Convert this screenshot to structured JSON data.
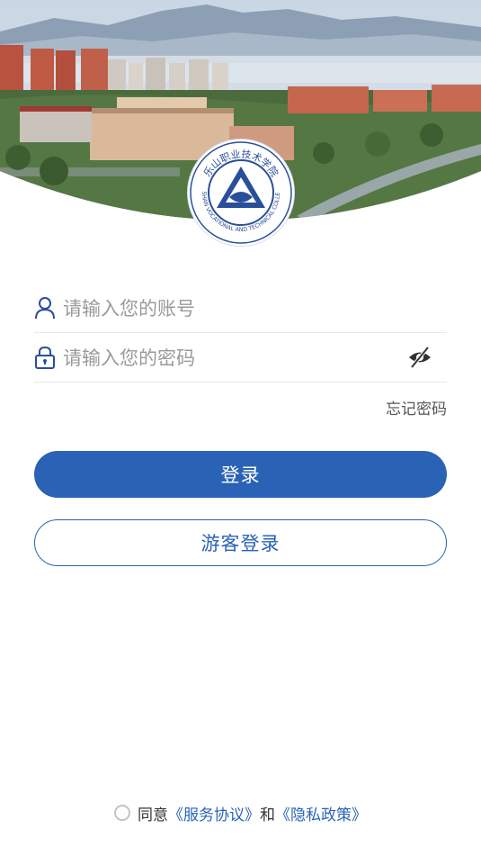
{
  "login": {
    "account_placeholder": "请输入您的账号",
    "password_placeholder": "请输入您的密码",
    "forgot_password": "忘记密码",
    "login_button": "登录",
    "guest_button": "游客登录"
  },
  "agreement": {
    "agree_text": "同意",
    "service_link": "《服务协议》",
    "and_text": "和",
    "privacy_link": "《隐私政策》"
  },
  "logo": {
    "school_cn": "乐山职业技术学院",
    "school_en": "LESHAN VOCATIONAL AND TECHNICAL COLLEGE"
  },
  "icons": {
    "account": "user-icon",
    "password": "lock-icon",
    "visibility": "eye-off-icon",
    "agree": "radio-unchecked-icon"
  },
  "colors": {
    "primary": "#2a63b6",
    "placeholder": "#9a9a9a",
    "divider": "#e8e8e8"
  }
}
